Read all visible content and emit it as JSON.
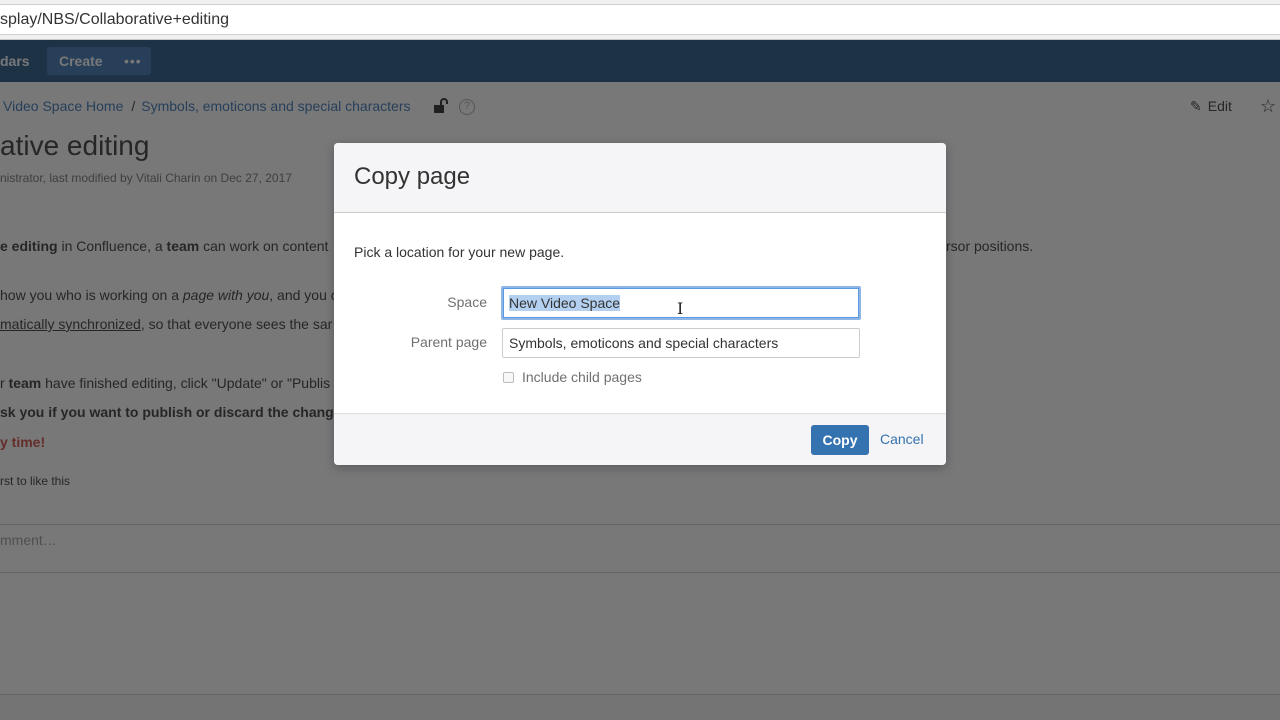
{
  "browser": {
    "url": "splay/NBS/Collaborative+editing"
  },
  "topnav": {
    "partial_item": "dars",
    "create_label": "Create",
    "more_label": "•••"
  },
  "breadcrumb": {
    "items": [
      "Video Space Home",
      "Symbols, emoticons and special characters"
    ],
    "separator": "/"
  },
  "page_actions": {
    "edit_label": "Edit",
    "pencil_glyph": "✎",
    "star_glyph": "☆",
    "help_glyph": "?"
  },
  "page": {
    "title": "ative editing",
    "meta": "nistrator, last modified by Vitali Charin on Dec 27, 2017",
    "line1": {
      "b1": "e editing",
      "t1": " in Confluence, a ",
      "b2": "team",
      "t2": " can work on content",
      "right": "rsor positions."
    },
    "line2": {
      "t1": "how you who is working on a ",
      "i1": "page with you",
      "t2": ", and you c"
    },
    "line3": {
      "u1": "matically synchronized",
      "t1": ", so that everyone sees the sar"
    },
    "line4": {
      "t1": "r ",
      "b1": "team",
      "t2": " have finished editing, click \"Update\" or \"Publis"
    },
    "line5": {
      "b1": "sk you if you want to publish or discard the chang"
    },
    "line6": {
      "red": "y time!"
    },
    "like_text": "rst to like this",
    "comment_placeholder": "mment…"
  },
  "dialog": {
    "title": "Copy page",
    "description": "Pick a location for your new page.",
    "space_label": "Space",
    "space_value": "New Video Space",
    "parent_label": "Parent page",
    "parent_value": "Symbols, emoticons and special characters",
    "include_children_label": "Include child pages",
    "include_children_checked": false,
    "copy_label": "Copy",
    "cancel_label": "Cancel",
    "cursor_glyph": "I"
  },
  "colors": {
    "nav_bg": "#205081",
    "primary": "#3572b0",
    "danger_text": "#d04437",
    "focus_ring": "#8eb6e4",
    "selection": "#b4d0f0"
  }
}
